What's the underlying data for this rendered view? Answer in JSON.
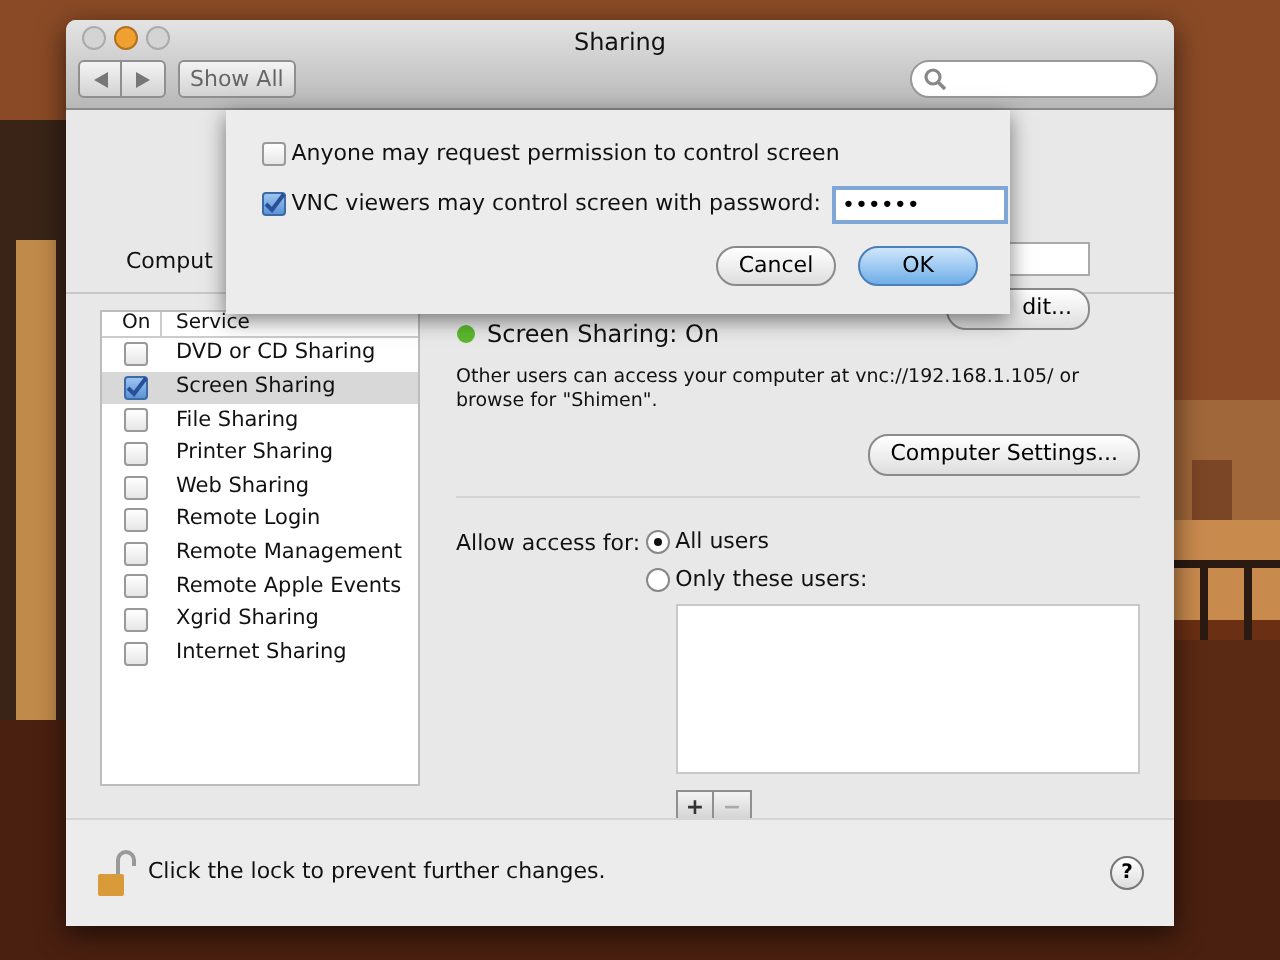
{
  "window": {
    "title": "Sharing"
  },
  "toolbar": {
    "show_all": "Show All"
  },
  "computer_name": {
    "label": "Comput",
    "edit_button": "dit..."
  },
  "sheet": {
    "options": [
      {
        "label": "Anyone may request permission to control screen",
        "checked": false
      },
      {
        "label": "VNC viewers may control screen with password:",
        "checked": true,
        "password": "••••••"
      }
    ],
    "buttons": [
      {
        "label": "Cancel",
        "default": false
      },
      {
        "label": "OK",
        "default": true
      }
    ]
  },
  "services": {
    "columns": [
      "On",
      "Service"
    ],
    "items": [
      {
        "name": "DVD or CD Sharing",
        "on": false,
        "selected": false
      },
      {
        "name": "Screen Sharing",
        "on": true,
        "selected": true
      },
      {
        "name": "File Sharing",
        "on": false,
        "selected": false
      },
      {
        "name": "Printer Sharing",
        "on": false,
        "selected": false
      },
      {
        "name": "Web Sharing",
        "on": false,
        "selected": false
      },
      {
        "name": "Remote Login",
        "on": false,
        "selected": false
      },
      {
        "name": "Remote Management",
        "on": false,
        "selected": false
      },
      {
        "name": "Remote Apple Events",
        "on": false,
        "selected": false
      },
      {
        "name": "Xgrid Sharing",
        "on": false,
        "selected": false
      },
      {
        "name": "Internet Sharing",
        "on": false,
        "selected": false
      }
    ]
  },
  "status": {
    "text": "Screen Sharing: On",
    "on": true
  },
  "description": "Other users can access your computer at vnc://192.168.1.105/ or browse for \"Shimen\".",
  "computer_settings": "Computer Settings...",
  "access": {
    "label": "Allow access for:",
    "options": [
      {
        "label": "All users",
        "selected": true
      },
      {
        "label": "Only these users:",
        "selected": false
      }
    ]
  },
  "user_list_buttons": [
    {
      "label": "+",
      "disabled": false
    },
    {
      "label": "−",
      "disabled": true
    }
  ],
  "lock": {
    "text": "Click the lock to prevent further changes.",
    "locked": false
  },
  "help": "?"
}
